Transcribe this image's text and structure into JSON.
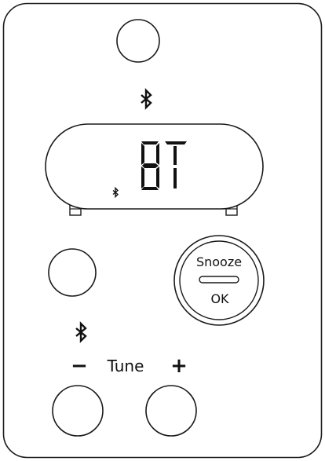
{
  "display": {
    "readout": "BT"
  },
  "buttons": {
    "snooze_label": "Snooze",
    "ok_label": "OK"
  },
  "tune": {
    "minus_label": "−",
    "label": "Tune",
    "plus_label": "+"
  },
  "icons": {
    "top_bluetooth": "bluetooth-icon",
    "display_bluetooth": "bluetooth-icon",
    "left_bluetooth": "bluetooth-icon"
  }
}
